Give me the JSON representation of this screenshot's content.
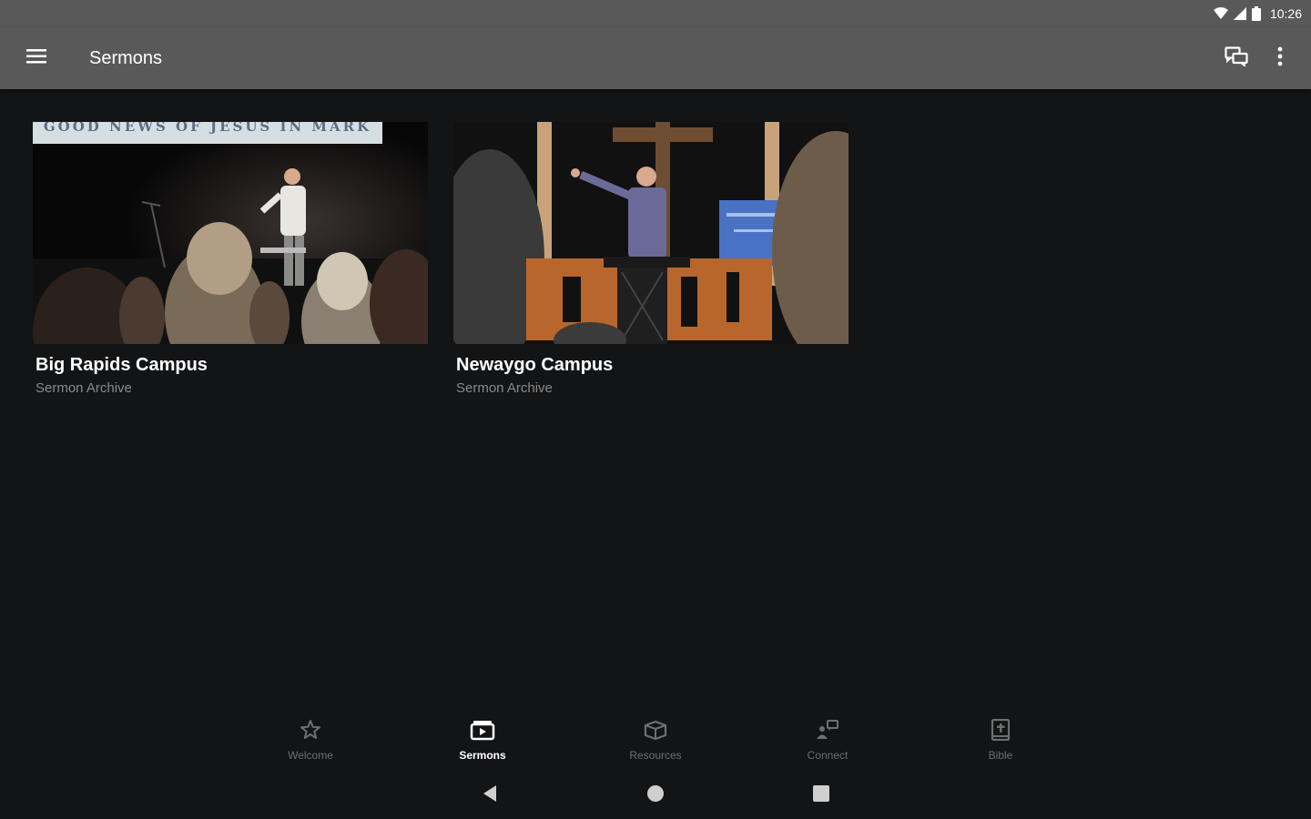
{
  "status_bar": {
    "time": "10:26",
    "icons": [
      "wifi-icon",
      "signal-icon",
      "battery-icon"
    ]
  },
  "app_bar": {
    "title": "Sermons",
    "menu_icon": "hamburger-menu-icon",
    "actions": [
      "chat-icon",
      "more-vert-icon"
    ]
  },
  "cards": [
    {
      "title": "Big Rapids Campus",
      "subtitle": "Sermon Archive",
      "banner_text": "GOOD NEWS OF JESUS IN MARK"
    },
    {
      "title": "Newaygo Campus",
      "subtitle": "Sermon Archive"
    }
  ],
  "bottom_nav": {
    "items": [
      {
        "label": "Welcome",
        "icon": "star-icon",
        "active": false
      },
      {
        "label": "Sermons",
        "icon": "sermon-video-icon",
        "active": true
      },
      {
        "label": "Resources",
        "icon": "box-icon",
        "active": false
      },
      {
        "label": "Connect",
        "icon": "connect-icon",
        "active": false
      },
      {
        "label": "Bible",
        "icon": "bible-icon",
        "active": false
      }
    ]
  },
  "system_nav": [
    "back-icon",
    "home-icon",
    "recents-icon"
  ],
  "colors": {
    "background": "#131416",
    "app_bar": "#595959",
    "inactive_nav": "#6f6f6f",
    "active_nav": "#ffffff",
    "subtitle": "#8a8a8a"
  }
}
